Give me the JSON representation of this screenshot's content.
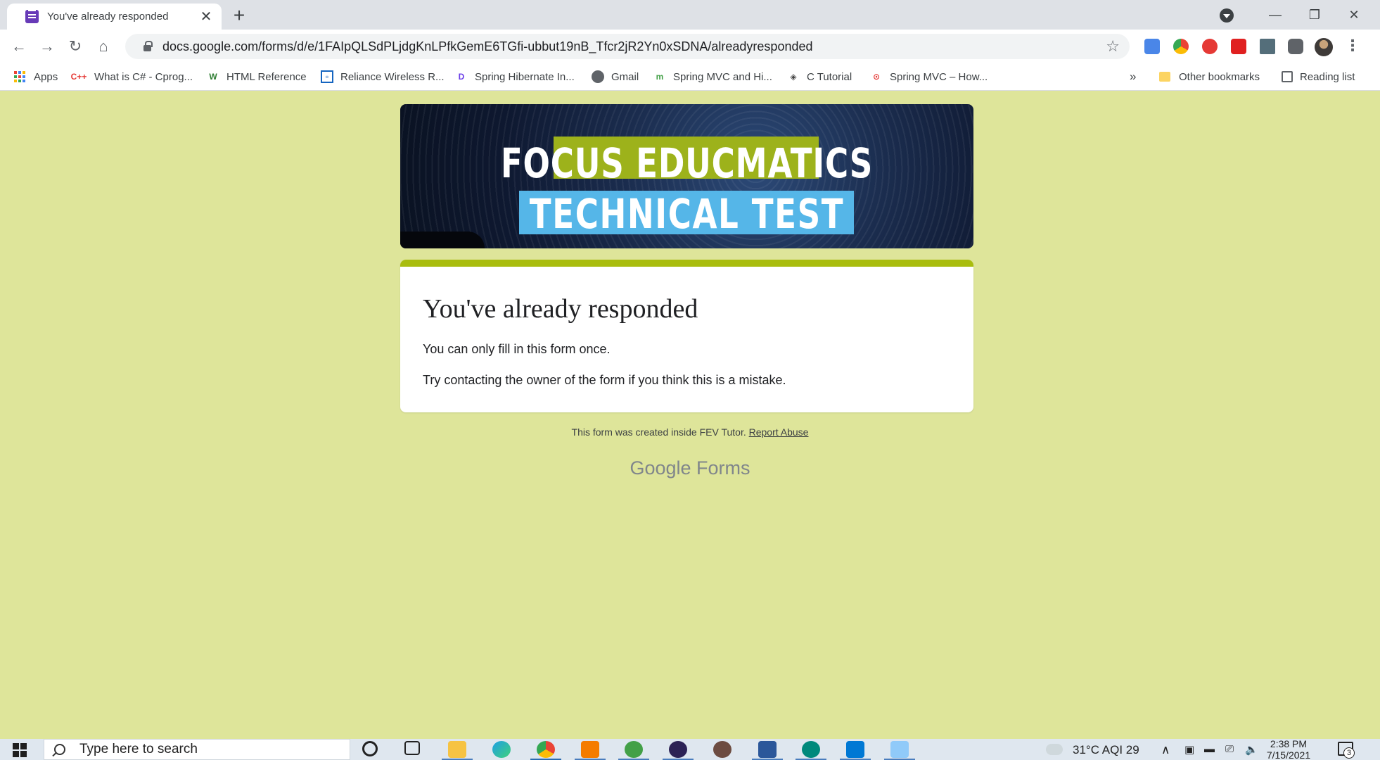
{
  "browser": {
    "tab_title": "You've already responded",
    "url": "docs.google.com/forms/d/e/1FAIpQLSdPLjdgKnLPfkGemE6TGfi-ubbut19nB_Tfcr2jR2Yn0xSDNA/alreadyresponded"
  },
  "bookmarks": {
    "items": [
      {
        "label": "Apps"
      },
      {
        "label": "What is C# - Cprog..."
      },
      {
        "label": "HTML Reference"
      },
      {
        "label": "Reliance Wireless R..."
      },
      {
        "label": "Spring Hibernate In..."
      },
      {
        "label": "Gmail"
      },
      {
        "label": "Spring MVC and Hi..."
      },
      {
        "label": "C Tutorial"
      },
      {
        "label": "Spring MVC – How..."
      }
    ],
    "overflow": "»",
    "other": "Other bookmarks",
    "reading_list": "Reading list"
  },
  "form": {
    "banner_line1": "FOCUS EDUCMATICS",
    "banner_line2": "TECHNICAL TEST",
    "title": "You've already responded",
    "message1": "You can only fill in this form once.",
    "message2": "Try contacting the owner of the form if you think this is a mistake.",
    "footer_note": "This form was created inside FEV Tutor.",
    "report_abuse": "Report Abuse",
    "brand_google": "Google",
    "brand_forms": "Forms"
  },
  "taskbar": {
    "search_placeholder": "Type here to search",
    "weather": "31°C  AQI 29",
    "time": "2:38 PM",
    "date": "7/15/2021",
    "notification_count": "3"
  },
  "colors": {
    "page_background": "#dee59a",
    "form_accent": "#a9bd0e",
    "banner_highlight_green": "#9db21b",
    "banner_highlight_blue": "#55b6e8"
  }
}
